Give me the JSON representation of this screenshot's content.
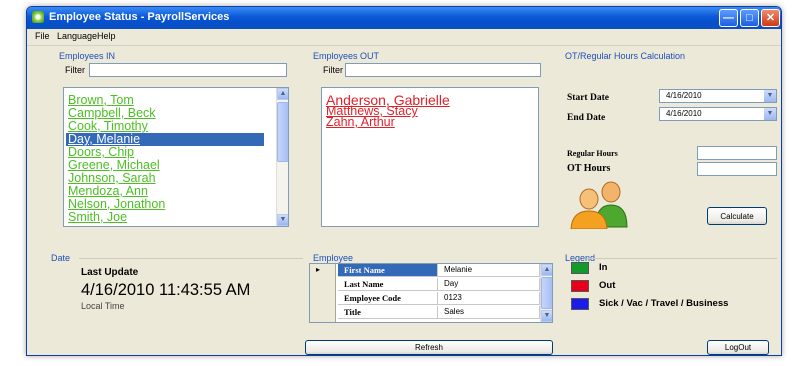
{
  "window": {
    "title": "Employee Status - PayrollServices"
  },
  "menu": [
    "File",
    "Language",
    "Help"
  ],
  "employees_in": {
    "label": "Employees IN",
    "filter_label": "Filter",
    "filter_value": "",
    "items": [
      "Brown, Tom",
      "Campbell, Beck",
      "Cook, Timothy",
      "Day, Melanie",
      "Doors, Chip",
      "Greene, Michael",
      "Johnson, Sarah",
      "Mendoza, Ann",
      "Nelson, Jonathon",
      "Smith, Joe"
    ],
    "selected_index": 3
  },
  "employees_out": {
    "label": "Employees OUT",
    "filter_label": "Filter",
    "filter_value": "",
    "items": [
      "Anderson, Gabrielle",
      "Matthews, Stacy",
      "Zahn, Arthur"
    ]
  },
  "calculator": {
    "label": "OT/Regular Hours Calculation",
    "start_label": "Start Date",
    "start_value": "4/16/2010",
    "end_label": "End Date",
    "end_value": "4/16/2010",
    "regular_label": "Regular Hours",
    "regular_value": "",
    "ot_label": "OT Hours",
    "ot_value": "",
    "calculate_label": "Calculate"
  },
  "date": {
    "label": "Date",
    "last_update_label": "Last Update",
    "timestamp": "4/16/2010 11:43:55 AM",
    "local_label": "Local Time"
  },
  "employee": {
    "label": "Employee",
    "rows": [
      {
        "key": "First Name",
        "value": "Melanie"
      },
      {
        "key": "Last Name",
        "value": "Day"
      },
      {
        "key": "Employee Code",
        "value": "0123"
      },
      {
        "key": "Title",
        "value": "Sales"
      }
    ],
    "current_row": 0
  },
  "legend": {
    "label": "Legend",
    "items": [
      {
        "color": "#149a2a",
        "label": "In"
      },
      {
        "color": "#e8001a",
        "label": "Out"
      },
      {
        "color": "#1c1ce8",
        "label": "Sick / Vac / Travel / Business"
      }
    ]
  },
  "refresh_label": "Refresh",
  "logout_label": "LogOut",
  "colors": {
    "titlebar": "#0a58d9",
    "in_text": "#4dbf24",
    "out_text": "#e0222a",
    "selection": "#3469b8"
  }
}
